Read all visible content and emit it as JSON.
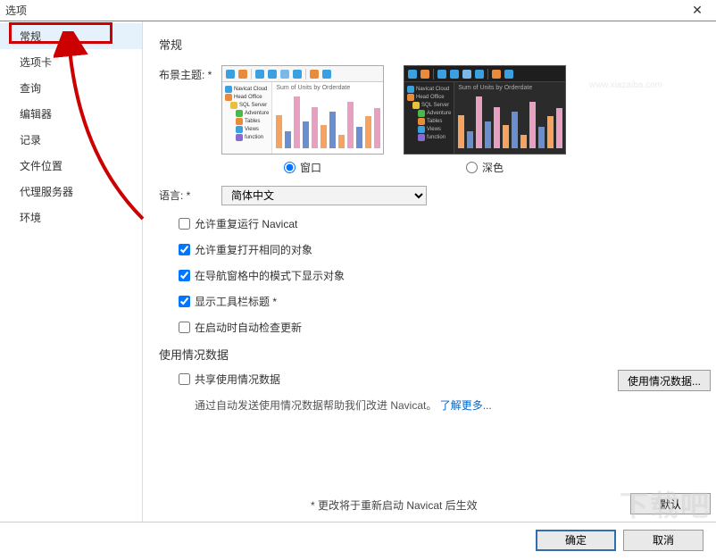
{
  "window": {
    "title": "选项"
  },
  "sidebar": {
    "items": [
      {
        "label": "常规"
      },
      {
        "label": "选项卡"
      },
      {
        "label": "查询"
      },
      {
        "label": "编辑器"
      },
      {
        "label": "记录"
      },
      {
        "label": "文件位置"
      },
      {
        "label": "代理服务器"
      },
      {
        "label": "环境"
      }
    ]
  },
  "general": {
    "heading": "常规",
    "theme_label": "布景主题: *",
    "theme_window": "窗口",
    "theme_dark": "深色",
    "lang_label": "语言: *",
    "lang_value": "简体中文",
    "checks": {
      "c1": "允许重复运行 Navicat",
      "c2": "允许重复打开相同的对象",
      "c3": "在导航窗格中的模式下显示对象",
      "c4": "显示工具栏标题 *",
      "c5": "在启动时自动检查更新"
    },
    "preview": {
      "chart_title": "Sum of Units by Orderdate",
      "tree": [
        "Navicat Cloud",
        "Head Office",
        "SQL Server",
        "Adventure",
        "Tables",
        "Views",
        "function"
      ]
    }
  },
  "usage": {
    "heading": "使用情况数据",
    "check": "共享使用情况数据",
    "desc_prefix": "通过自动发送使用情况数据帮助我们改进 Navicat。",
    "link": "了解更多...",
    "button": "使用情况数据..."
  },
  "note": "* 更改将于重新启动 Navicat 后生效",
  "buttons": {
    "default": "默认",
    "ok": "确定",
    "cancel": "取消"
  },
  "chart_data": {
    "type": "bar",
    "title": "Sum of Units by Orderdate",
    "values": [
      50,
      25,
      78,
      40,
      62,
      35,
      55,
      20,
      70,
      32,
      48,
      60
    ],
    "colors": [
      "#f4a460",
      "#6b8ecf",
      "#e8a0c0",
      "#6b8ecf",
      "#e8a0c0",
      "#f4a460",
      "#6b8ecf",
      "#f4a460",
      "#e8a0c0",
      "#6b8ecf",
      "#f4a460",
      "#e8a0c0"
    ]
  }
}
